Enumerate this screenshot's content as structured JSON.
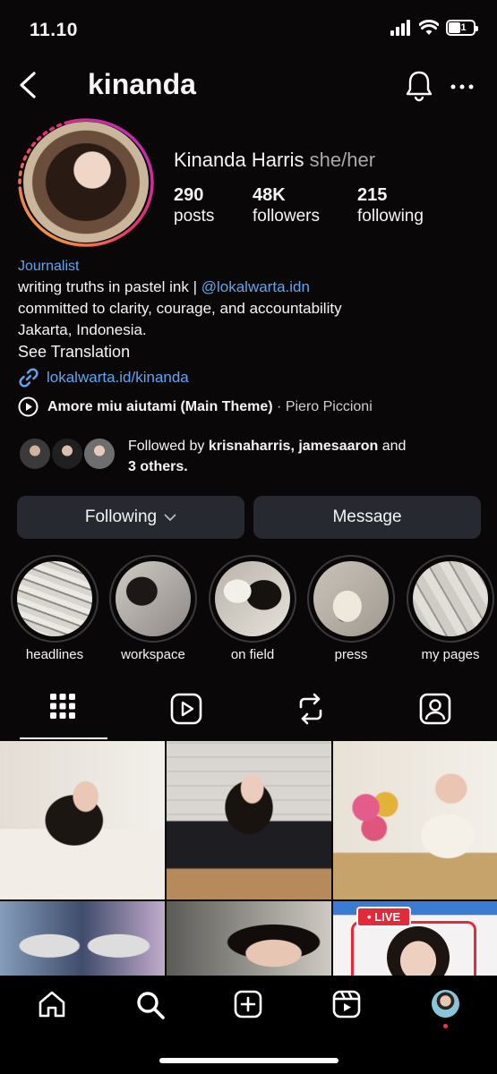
{
  "status_bar": {
    "time": "11.10",
    "battery": "41"
  },
  "header": {
    "username": "kinanda"
  },
  "profile": {
    "display_name": "Kinanda Harris",
    "pronouns": "she/her",
    "stats": [
      {
        "value": "290",
        "label": "posts"
      },
      {
        "value": "48K",
        "label": "followers"
      },
      {
        "value": "215",
        "label": "following"
      }
    ],
    "category": "Journalist",
    "bio_line1_prefix": "writing truths in pastel ink | ",
    "bio_line1_mention": "@lokalwarta.idn",
    "bio_line2": "committed to clarity, courage, and accountability",
    "bio_line3": "Jakarta, Indonesia.",
    "see_translation": "See Translation",
    "link": "lokalwarta.id/kinanda",
    "music_title": "Amore miu aiutami (Main Theme)",
    "music_artist": "· Piero Piccioni",
    "followed_by_prefix": "Followed by ",
    "followed_by_names": "krisnaharris, jamesaaron",
    "followed_by_and": " and",
    "followed_by_others": "3 others."
  },
  "actions": {
    "following": "Following",
    "message": "Message"
  },
  "highlights": [
    {
      "label": "headlines"
    },
    {
      "label": "workspace"
    },
    {
      "label": "on field"
    },
    {
      "label": "press"
    },
    {
      "label": "my pages"
    }
  ],
  "grid": {
    "live_badge": "• LIVE"
  },
  "colors": {
    "background": "#0a0708",
    "link_blue": "#5fa6ef",
    "button_bg": "#262a30",
    "live_red": "#e22a3a"
  }
}
